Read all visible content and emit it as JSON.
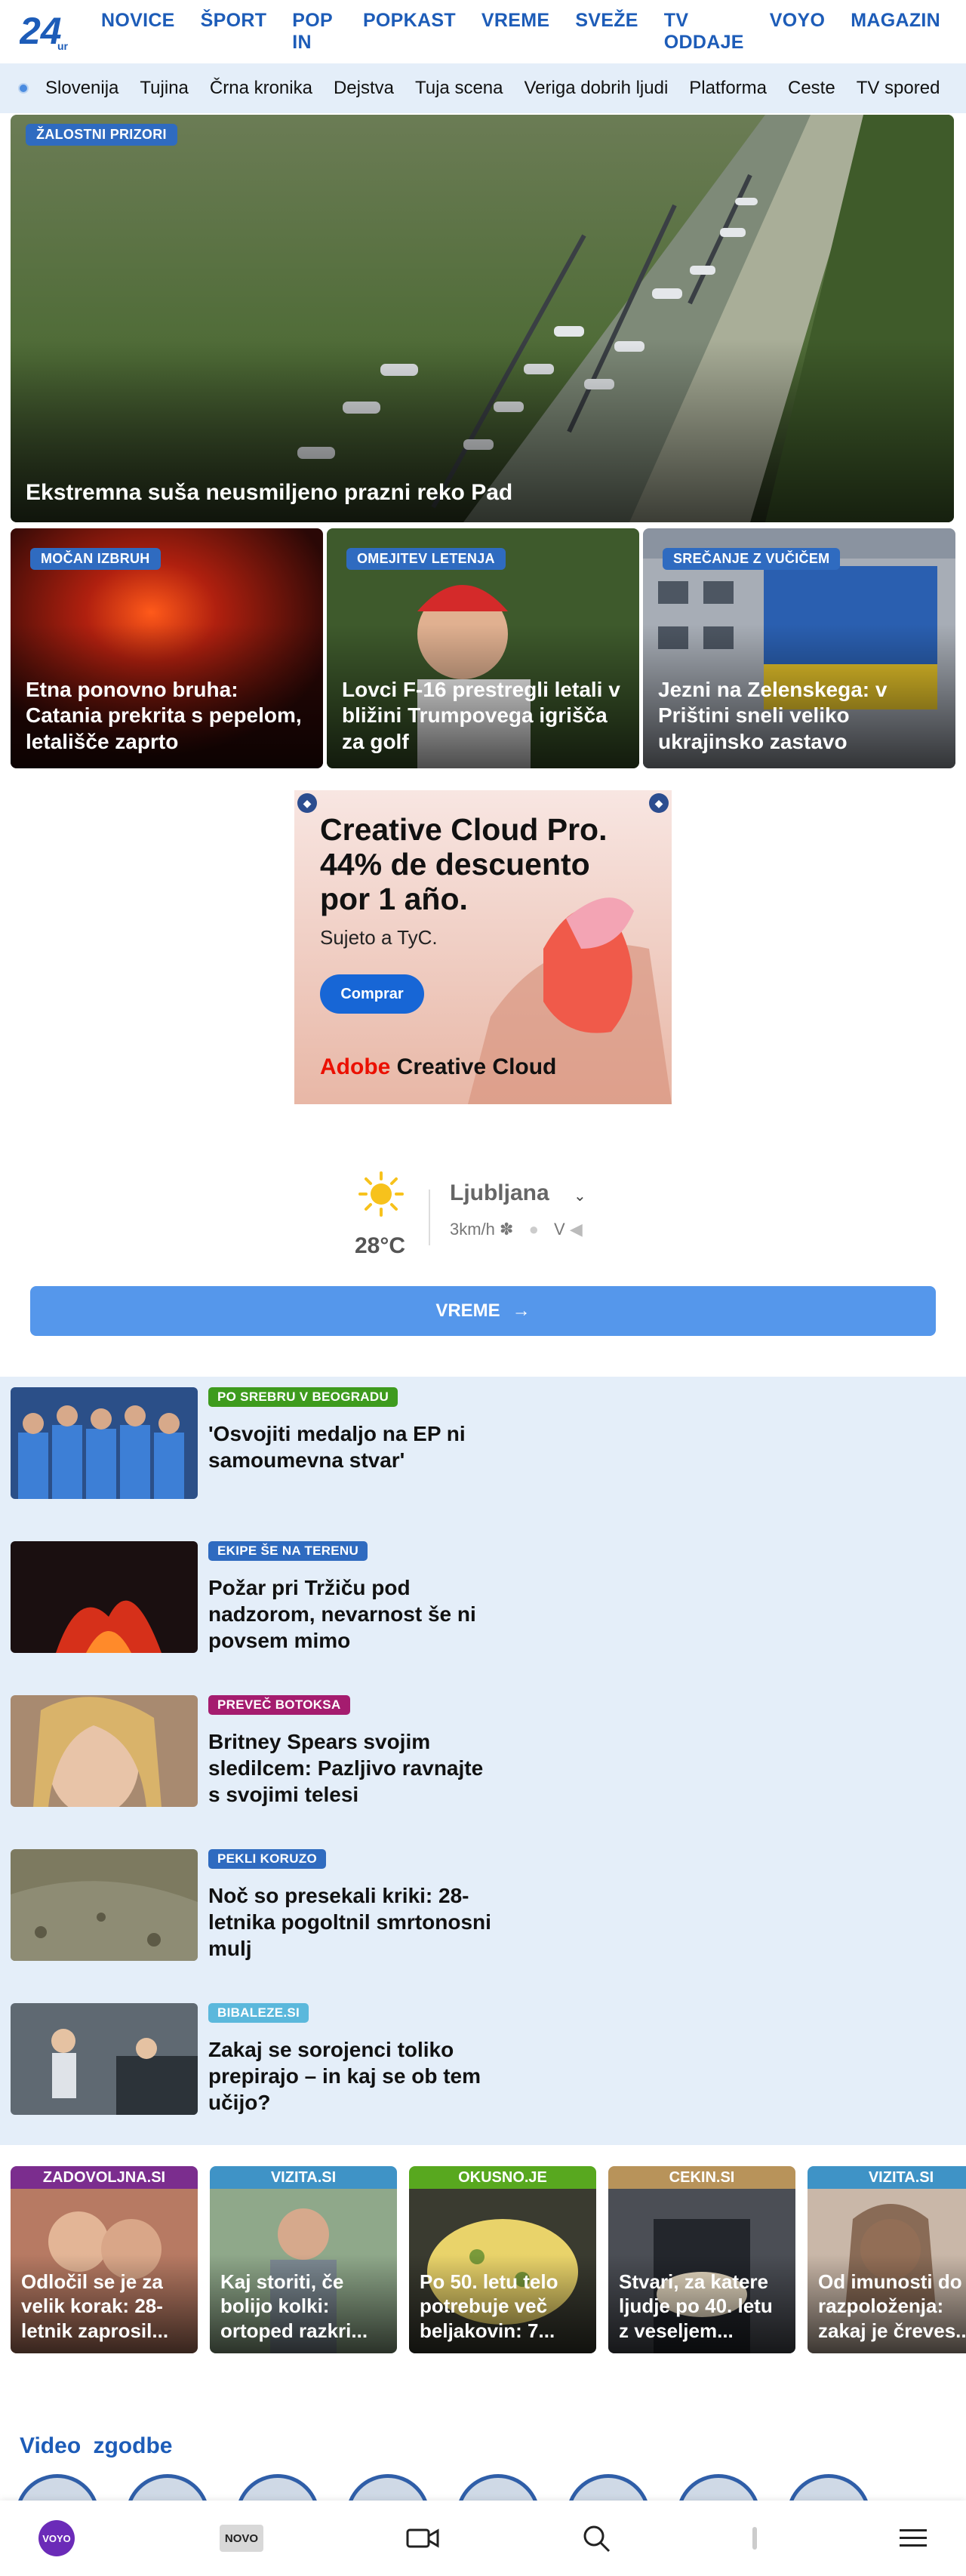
{
  "brand": {
    "logo_text": "24",
    "logo_suffix": "ur"
  },
  "nav": {
    "items": [
      "NOVICE",
      "ŠPORT",
      "POP IN",
      "POPKAST",
      "VREME",
      "SVEŽE",
      "TV ODDAJE",
      "VOYO",
      "MAGAZIN"
    ]
  },
  "subnav": {
    "items": [
      "Slovenija",
      "Tujina",
      "Črna kronika",
      "Dejstva",
      "Tuja scena",
      "Veriga dobrih ljudi",
      "Platforma",
      "Ceste",
      "TV spored"
    ]
  },
  "hero": {
    "badge": "ŽALOSTNI PRIZORI",
    "title": "Ekstremna suša neusmiljeno prazni reko Pad"
  },
  "cards": [
    {
      "badge": "MOČAN IZBRUH",
      "title": "Etna ponovno bruha: Catania prekrita s pepelom, letališče zaprto"
    },
    {
      "badge": "OMEJITEV LETENJA",
      "title": "Lovci F-16 prestregli letali v bližini Trumpovega igrišča za golf"
    },
    {
      "badge": "SREČANJE Z VUČIČEM",
      "title": "Jezni na Zelenskega: v Prištini sneli veliko ukrajinsko zastavo"
    }
  ],
  "ad": {
    "headline_1": "Creative Cloud Pro.",
    "headline_2": "44% de descuento",
    "headline_3": "por 1 año.",
    "sub": "Sujeto a TyC.",
    "cta": "Comprar",
    "brand_1": "Adobe",
    "brand_2": " Creative Cloud"
  },
  "weather": {
    "temp": "28°C",
    "city": "Ljubljana",
    "wind_speed": "3km/h",
    "wind_dir": "V",
    "button": "VREME"
  },
  "list": [
    {
      "badge": "PO SREBRU V BEOGRADU",
      "badge_color": "#3e9b1e",
      "title": "'Osvojiti medaljo na EP ni samoumevna stvar'"
    },
    {
      "badge": "EKIPE ŠE NA TERENU",
      "badge_color": "#2f6bc0",
      "title": "Požar pri Tržiču pod nadzorom, nevarnost še ni povsem mimo"
    },
    {
      "badge": "PREVEČ BOTOKSA",
      "badge_color": "#a51c6f",
      "title": "Britney Spears svojim sledilcem: Pazljivo ravnajte s svojimi telesi"
    },
    {
      "badge": "PEKLI KORUZO",
      "badge_color": "#2f6bc0",
      "title": "Noč so presekali kriki: 28-letnika pogoltnil smrtonosni mulj"
    },
    {
      "badge": "BIBALEZE.SI",
      "badge_color": "#5bb8dc",
      "title": "Zakaj se sorojenci toliko prepirajo – in kaj se ob tem učijo?"
    }
  ],
  "partners": [
    {
      "tag": "ZADOVOLJNA.SI",
      "color": "#7b2d8e",
      "line1": "Odločil se je za",
      "line2": "velik korak: 28-",
      "line3": "letnik zaprosil..."
    },
    {
      "tag": "VIZITA.SI",
      "color": "#3f93c6",
      "line1": "Kaj storiti, če",
      "line2": "bolijo kolki:",
      "line3": "ortoped razkri..."
    },
    {
      "tag": "OKUSNO.JE",
      "color": "#58a81f",
      "line1": "Po 50. letu telo",
      "line2": "potrebuje več",
      "line3": "beljakovin: 7..."
    },
    {
      "tag": "CEKIN.SI",
      "color": "#b8935a",
      "line1": "Stvari, za katere",
      "line2": "ljudje po 40. letu",
      "line3": "z veseljem..."
    },
    {
      "tag": "VIZITA.SI",
      "color": "#3f93c6",
      "line1": "Od imunosti do",
      "line2": "razpoloženja:",
      "line3": "zakaj je čreves..."
    }
  ],
  "video": {
    "word1": "Video",
    "word2": "zgodbe"
  },
  "bottom": {
    "voyo": "VOYO",
    "novo": "NOVO"
  }
}
